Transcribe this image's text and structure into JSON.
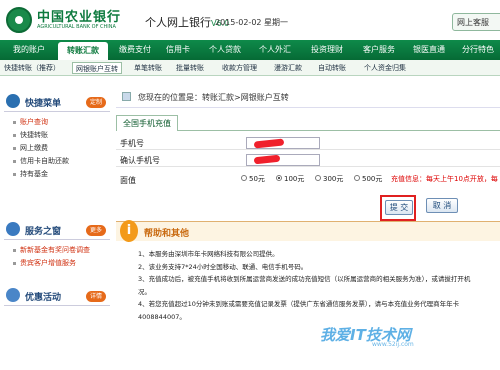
{
  "header": {
    "bank_name_cn": "中国农业银行",
    "bank_name_en": "AGRICULTURAL BANK OF CHINA",
    "ebank_title": "个人网上银行",
    "version": "V6.0",
    "date": "2015-02-02 星期一",
    "top_right_label": "网上客服"
  },
  "nav": {
    "items": [
      "我的账户",
      "转账汇款",
      "缴费支付",
      "信用卡",
      "个人贷款",
      "个人外汇",
      "投资理财",
      "客户服务",
      "银医直通",
      "分行特色"
    ],
    "active_index": 1
  },
  "subnav": {
    "items": [
      "快捷转账（推荐）",
      "网银账户互转",
      "单笔转账",
      "批量转账",
      "收款方管理",
      "漫游汇款",
      "自动转账",
      "个人资金归集"
    ],
    "active_index": 1
  },
  "sidebar": {
    "quick_menu": {
      "title": "快捷菜单",
      "button": "定制",
      "items": [
        "账户查询",
        "快捷转账",
        "网上缴费",
        "信用卡自助还款",
        "持有基金"
      ]
    },
    "service": {
      "title": "服务之窗",
      "button": "更多",
      "items": [
        "新新基金有奖问卷调查",
        "贵宾客户增值服务"
      ]
    },
    "promo": {
      "title": "优惠活动",
      "button": "详情"
    }
  },
  "main": {
    "breadcrumb": "您现在的位置是：转账汇款>网银账户互转",
    "tab_label": "全国手机充值",
    "form": {
      "phone_label": "手机号",
      "confirm_label": "确认手机号",
      "amount_label": "面值",
      "amount_options": [
        "50元",
        "100元",
        "300元",
        "500元"
      ],
      "selected_amount_index": 1,
      "notice": "充值信息：每天上午10点开放，每"
    },
    "buttons": {
      "submit": "提 交",
      "cancel": "取 消"
    },
    "help": {
      "title": "帮助和其他",
      "lines": [
        "1、本服务由深圳市年卡网络科技有限公司提供。",
        "2、该业务支持7*24小时全国移动、联通、电信手机号码。",
        "3、充值成功后，被充值手机将收到所属运营商发送的成功充值短信（以所属运营商的相关服务为准），或请拔打开机",
        "况。",
        "4、若您充值超过10分钟未到账或需要充值记录发票（提供广东省通信服务发票），请与本充值业务代理商年年卡",
        "4008844007。"
      ]
    }
  },
  "watermark": {
    "text": "我爱IT技术网",
    "url_text": "www.52ij.com"
  }
}
